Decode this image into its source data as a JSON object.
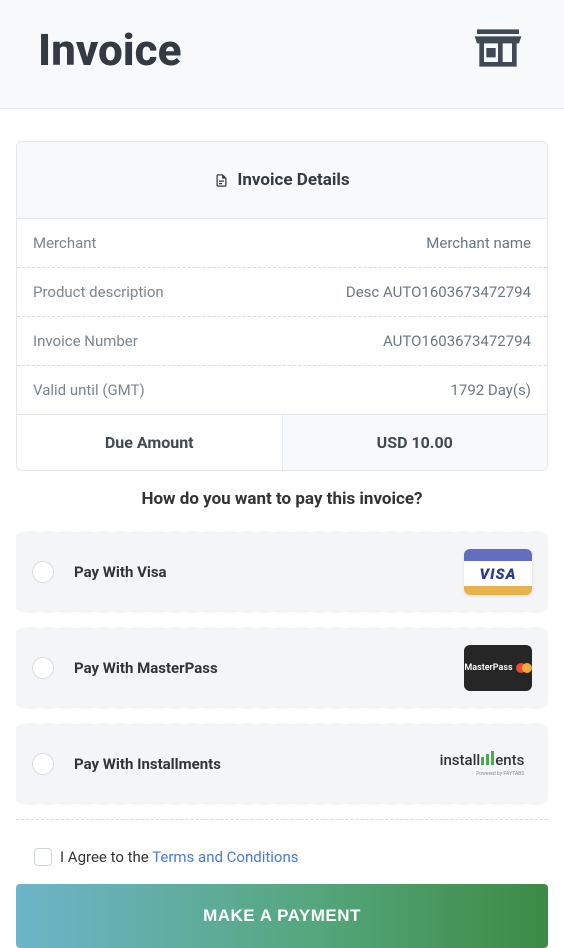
{
  "header": {
    "title": "Invoice"
  },
  "card": {
    "title": "Invoice Details"
  },
  "details": {
    "merchant_label": "Merchant",
    "merchant_value": "Merchant name",
    "product_label": "Product description",
    "product_value": "Desc AUTO1603673472794",
    "invoice_number_label": "Invoice Number",
    "invoice_number_value": "AUTO1603673472794",
    "valid_until_label": "Valid until (GMT)",
    "valid_until_value": "1792 Day(s)",
    "due_label": "Due Amount",
    "due_value": "USD 10.00"
  },
  "question": "How do you want to pay this invoice?",
  "options": {
    "visa": "Pay With Visa",
    "masterpass": "Pay With MasterPass",
    "installments": "Pay With Installments"
  },
  "logos": {
    "visa_text": "VISA",
    "masterpass_text": "MasterPass",
    "installments_prefix": "install",
    "installments_suffix": "ents",
    "installments_sub": "Powered by PAYTABS"
  },
  "agree": {
    "prefix": "I Agree to the ",
    "link": "Terms and Conditions"
  },
  "button": {
    "label": "MAKE A PAYMENT"
  }
}
